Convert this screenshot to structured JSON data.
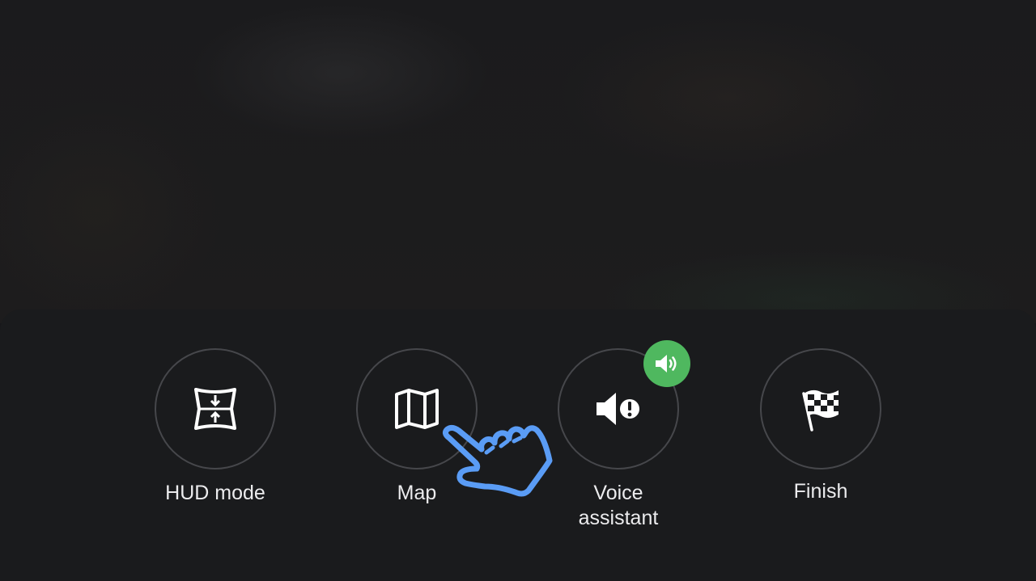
{
  "actions": [
    {
      "label": "HUD mode",
      "icon": "hud-mode-icon"
    },
    {
      "label": "Map",
      "icon": "map-icon"
    },
    {
      "label": "Voice\nassistant",
      "icon": "speaker-alert-icon",
      "badge_icon": "speaker-volume-icon",
      "badge_color": "#4fb85f"
    },
    {
      "label": "Finish",
      "icon": "checkered-flag-icon"
    }
  ],
  "pointer": {
    "icon": "pointing-hand-icon",
    "color": "#5a9cf5",
    "target": "Map"
  }
}
